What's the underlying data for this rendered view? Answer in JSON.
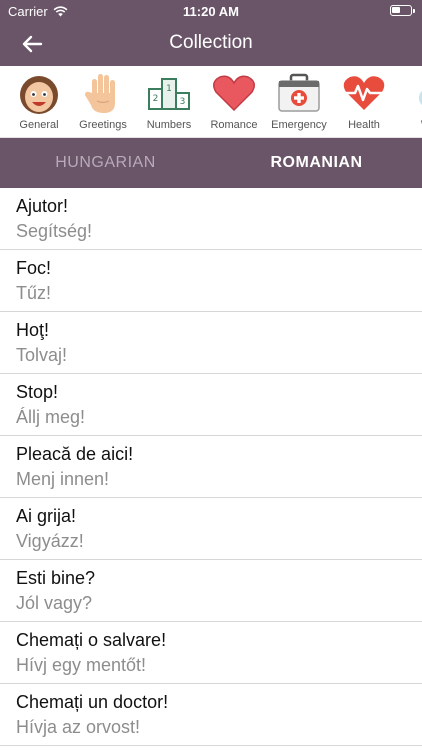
{
  "status_bar": {
    "carrier": "Carrier",
    "time": "11:20 AM"
  },
  "nav": {
    "title": "Collection"
  },
  "categories": [
    {
      "label": "General",
      "icon": "smiling-girl-icon"
    },
    {
      "label": "Greetings",
      "icon": "waving-hand-icon"
    },
    {
      "label": "Numbers",
      "icon": "podium-123-icon"
    },
    {
      "label": "Romance",
      "icon": "heart-icon"
    },
    {
      "label": "Emergency",
      "icon": "first-aid-kit-icon"
    },
    {
      "label": "Health",
      "icon": "heartbeat-icon"
    },
    {
      "label": "We",
      "icon": "partial-category-icon"
    }
  ],
  "language_tabs": {
    "left": "HUNGARIAN",
    "right": "ROMANIAN",
    "active": "right"
  },
  "phrases": [
    {
      "src": "Ajutor!",
      "tr": "Segítség!"
    },
    {
      "src": "Foc!",
      "tr": "Tűz!"
    },
    {
      "src": "Hoţ!",
      "tr": "Tolvaj!"
    },
    {
      "src": "Stop!",
      "tr": "Állj meg!"
    },
    {
      "src": "Pleacă de aici!",
      "tr": "Menj innen!"
    },
    {
      "src": "Ai grija!",
      "tr": "Vigyázz!"
    },
    {
      "src": "Esti bine?",
      "tr": "Jól vagy?"
    },
    {
      "src": "Chemați o salvare!",
      "tr": "Hívj egy mentőt!"
    },
    {
      "src": "Chemați un doctor!",
      "tr": "Hívja az orvost!"
    }
  ],
  "colors": {
    "accent": "#6a5568",
    "inactive_tab": "#b8aab6",
    "translation": "#8d8d8d"
  }
}
